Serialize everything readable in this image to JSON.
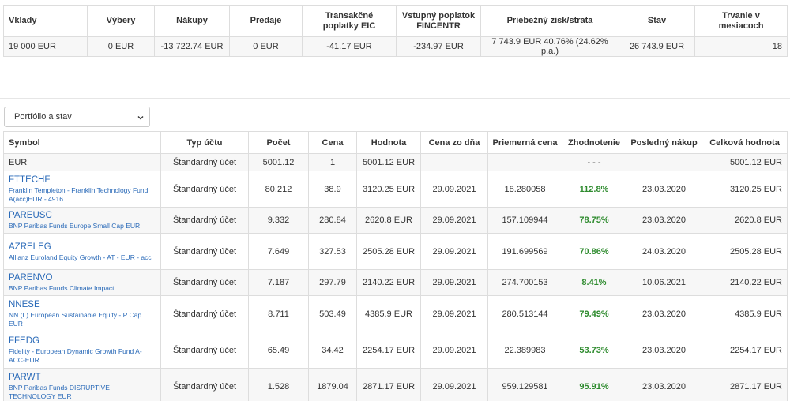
{
  "summary": {
    "headers": [
      "Vklady",
      "Výbery",
      "Nákupy",
      "Predaje",
      "Transakčné poplatky EIC",
      "Vstupný poplatok FINCENTR",
      "Priebežný zisk/strata",
      "Stav",
      "Trvanie v mesiacoch"
    ],
    "values": [
      "19 000 EUR",
      "0 EUR",
      "-13 722.74 EUR",
      "0 EUR",
      "-41.17 EUR",
      "-234.97 EUR",
      "7 743.9 EUR 40.76% (24.62% p.a.)",
      "26 743.9 EUR",
      "18"
    ]
  },
  "view_select": {
    "selected": "Portfólio a stav"
  },
  "portfolio": {
    "headers": [
      "Symbol",
      "Typ účtu",
      "Počet",
      "Cena",
      "Hodnota",
      "Cena zo dňa",
      "Priemerná cena",
      "Zhodnotenie",
      "Posledný nákup",
      "Celková hodnota"
    ],
    "rows": [
      {
        "code": "EUR",
        "name": "",
        "account": "Štandardný účet",
        "qty": "5001.12",
        "price": "1",
        "value": "5001.12 EUR",
        "price_date": "",
        "avg_price": "",
        "gain": "- - -",
        "last_buy": "",
        "total": "5001.12 EUR"
      },
      {
        "code": "FTTECHF",
        "name": "Franklin Templeton - Franklin Technology Fund A(acc)EUR - 4916",
        "account": "Štandardný účet",
        "qty": "80.212",
        "price": "38.9",
        "value": "3120.25 EUR",
        "price_date": "29.09.2021",
        "avg_price": "18.280058",
        "gain": "112.8%",
        "last_buy": "23.03.2020",
        "total": "3120.25 EUR"
      },
      {
        "code": "PAREUSC",
        "name": "BNP Paribas Funds Europe Small Cap EUR",
        "account": "Štandardný účet",
        "qty": "9.332",
        "price": "280.84",
        "value": "2620.8 EUR",
        "price_date": "29.09.2021",
        "avg_price": "157.109944",
        "gain": "78.75%",
        "last_buy": "23.03.2020",
        "total": "2620.8 EUR"
      },
      {
        "code": "AZRELEG",
        "name": "Allianz Euroland Equity Growth - AT - EUR - acc",
        "account": "Štandardný účet",
        "qty": "7.649",
        "price": "327.53",
        "value": "2505.28 EUR",
        "price_date": "29.09.2021",
        "avg_price": "191.699569",
        "gain": "70.86%",
        "last_buy": "24.03.2020",
        "total": "2505.28 EUR"
      },
      {
        "code": "PARENVO",
        "name": "BNP Paribas Funds Climate Impact",
        "account": "Štandardný účet",
        "qty": "7.187",
        "price": "297.79",
        "value": "2140.22 EUR",
        "price_date": "29.09.2021",
        "avg_price": "274.700153",
        "gain": "8.41%",
        "last_buy": "10.06.2021",
        "total": "2140.22 EUR"
      },
      {
        "code": "NNESE",
        "name": "NN (L) European Sustainable Equity - P Cap EUR",
        "account": "Štandardný účet",
        "qty": "8.711",
        "price": "503.49",
        "value": "4385.9 EUR",
        "price_date": "29.09.2021",
        "avg_price": "280.513144",
        "gain": "79.49%",
        "last_buy": "23.03.2020",
        "total": "4385.9 EUR"
      },
      {
        "code": "FFEDG",
        "name": "Fidelity - European Dynamic Growth Fund A-ACC-EUR",
        "account": "Štandardný účet",
        "qty": "65.49",
        "price": "34.42",
        "value": "2254.17 EUR",
        "price_date": "29.09.2021",
        "avg_price": "22.389983",
        "gain": "53.73%",
        "last_buy": "23.03.2020",
        "total": "2254.17 EUR"
      },
      {
        "code": "PARWT",
        "name": "BNP Paribas Funds DISRUPTIVE TECHNOLOGY EUR",
        "account": "Štandardný účet",
        "qty": "1.528",
        "price": "1879.04",
        "value": "2871.17 EUR",
        "price_date": "29.09.2021",
        "avg_price": "959.129581",
        "gain": "95.91%",
        "last_buy": "23.03.2020",
        "total": "2871.17 EUR"
      }
    ]
  },
  "colors": {
    "link": "#2a6ab8",
    "positive": "#2e8b2e",
    "row_alt": "#f7f7f7",
    "border": "#dddddd"
  },
  "icons": {
    "dropdown": "chevron-down-icon"
  }
}
